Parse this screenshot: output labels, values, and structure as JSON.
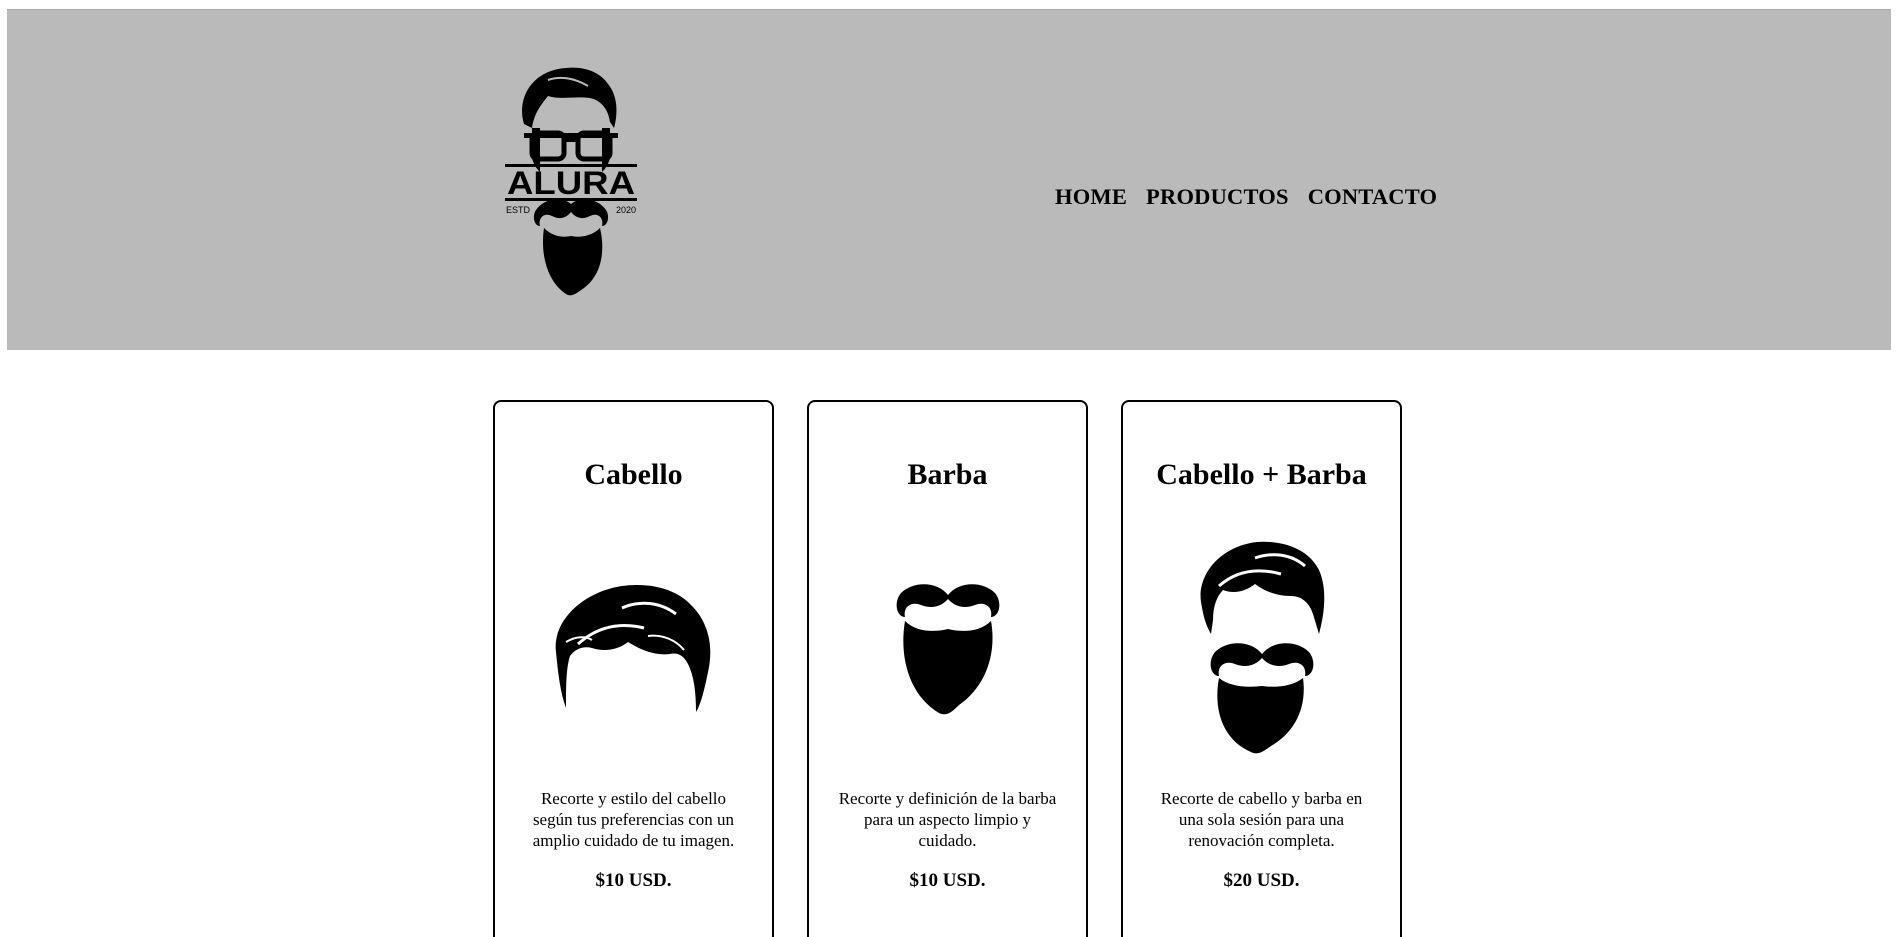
{
  "header": {
    "logo": {
      "icon": "bearded-man-logo-icon",
      "brand": "ALURA",
      "left_text": "ESTD",
      "right_text": "2020"
    },
    "nav": [
      {
        "label": "HOME"
      },
      {
        "label": "PRODUCTOS"
      },
      {
        "label": "CONTACTO"
      }
    ],
    "background_color": "#bababa"
  },
  "products": [
    {
      "title": "Cabello",
      "icon": "hair-icon",
      "description": "Recorte y estilo del cabello según tus preferencias con un amplio cuidado de tu imagen.",
      "price": "$10 USD."
    },
    {
      "title": "Barba",
      "icon": "beard-icon",
      "description": "Recorte y definición de la barba para un aspecto limpio y cuidado.",
      "price": "$10 USD."
    },
    {
      "title": "Cabello + Barba",
      "icon": "hair-and-beard-icon",
      "description": "Recorte de cabello y barba en una sola sesión para una renovación completa.",
      "price": "$20 USD."
    }
  ]
}
